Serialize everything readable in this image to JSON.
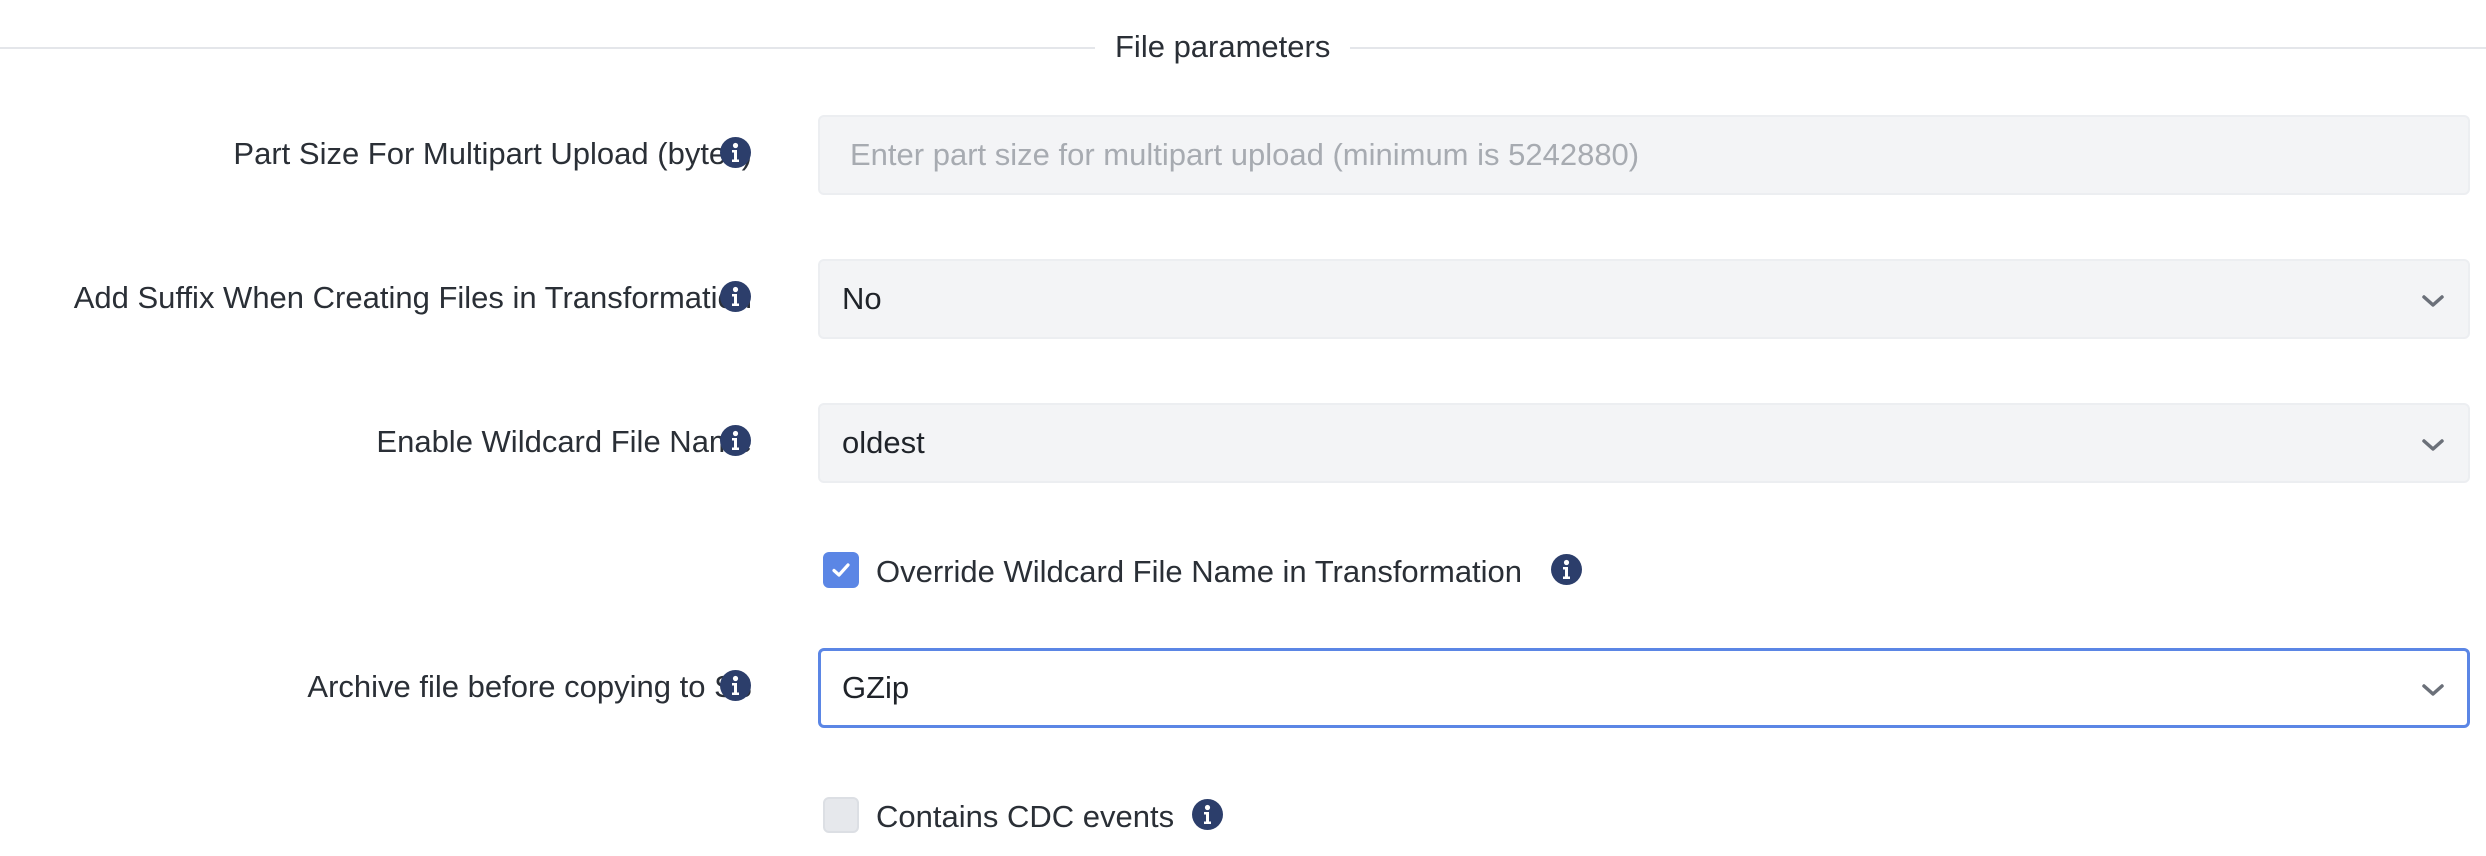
{
  "section": {
    "title": "File parameters"
  },
  "fields": {
    "part_size": {
      "label": "Part Size For Multipart Upload (bytes)",
      "placeholder": "Enter part size for multipart upload (minimum is 5242880)",
      "value": ""
    },
    "add_suffix": {
      "label": "Add Suffix When Creating Files in Transformation",
      "value": "No"
    },
    "wildcard": {
      "label": "Enable Wildcard File Name",
      "value": "oldest"
    },
    "override_wildcard": {
      "label": "Override Wildcard File Name in Transformation",
      "checked": true
    },
    "archive": {
      "label": "Archive file before copying to S3",
      "value": "GZip"
    },
    "cdc": {
      "label": "Contains CDC events",
      "checked": false
    }
  },
  "icons": {
    "info": "info-icon",
    "dropdown": "chevron-down-icon",
    "check": "check-icon"
  },
  "colors": {
    "accent": "#5b86e5",
    "info_icon": "#2c3e6b",
    "field_background": "#f3f4f6",
    "placeholder": "#a7abb1"
  }
}
